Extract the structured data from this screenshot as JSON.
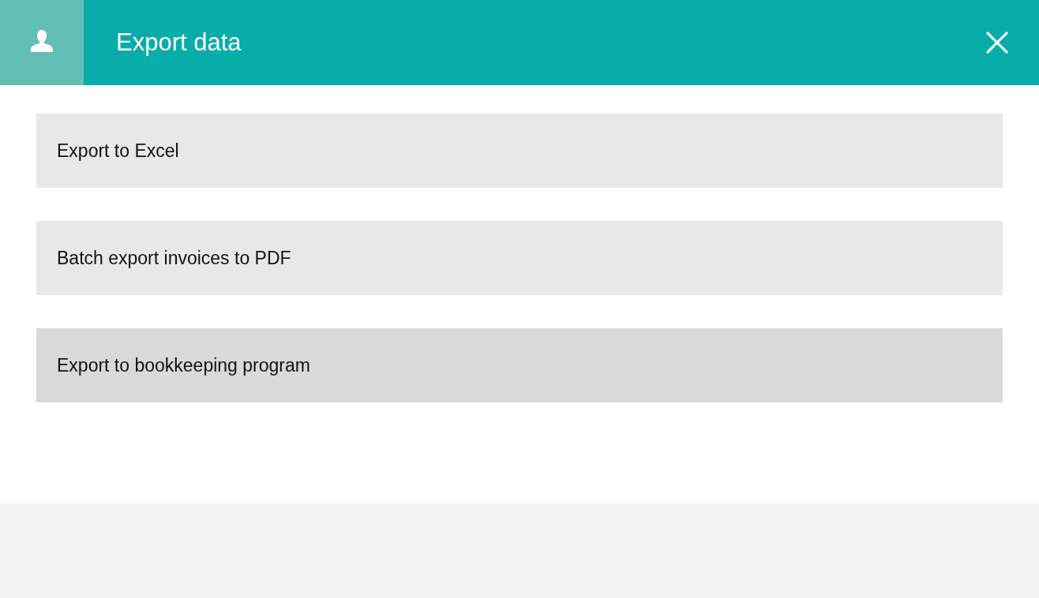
{
  "dialog": {
    "title": "Export data"
  },
  "options": [
    {
      "label": "Export to Excel",
      "selected": false
    },
    {
      "label": "Batch export invoices to PDF",
      "selected": false
    },
    {
      "label": "Export to bookkeeping program",
      "selected": true
    }
  ]
}
